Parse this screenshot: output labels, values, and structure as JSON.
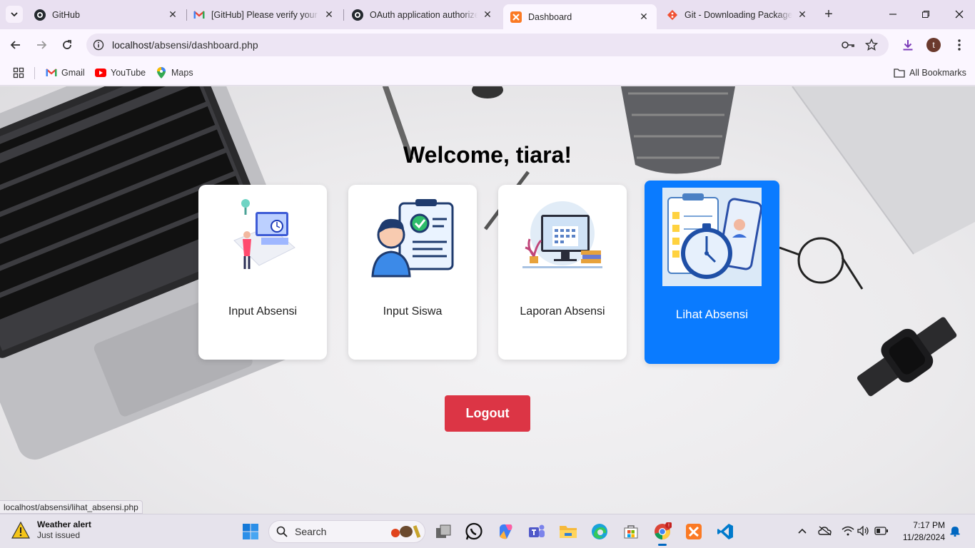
{
  "browser": {
    "tabs": [
      {
        "title": "GitHub",
        "icon": "github-icon",
        "active": false
      },
      {
        "title": "[GitHub] Please verify your d",
        "icon": "gmail-icon",
        "active": false
      },
      {
        "title": "OAuth application authorize",
        "icon": "github-icon",
        "active": false
      },
      {
        "title": "Dashboard",
        "icon": "xampp-icon",
        "active": true
      },
      {
        "title": "Git - Downloading Package",
        "icon": "git-icon",
        "active": false
      }
    ],
    "url_host": "localhost",
    "url_path": "/absensi/dashboard.php",
    "bookmarks": [
      {
        "label": "Gmail",
        "icon": "gmail-icon"
      },
      {
        "label": "YouTube",
        "icon": "youtube-icon"
      },
      {
        "label": "Maps",
        "icon": "maps-icon"
      }
    ],
    "all_bookmarks": "All Bookmarks",
    "profile_initial": "t"
  },
  "page": {
    "welcome": "Welcome, tiara!",
    "cards": [
      {
        "label": "Input Absensi",
        "highlighted": false
      },
      {
        "label": "Input Siswa",
        "highlighted": false
      },
      {
        "label": "Laporan Absensi",
        "highlighted": false
      },
      {
        "label": "Lihat Absensi",
        "highlighted": true
      }
    ],
    "logout": "Logout",
    "status_url": "localhost/absensi/lihat_absensi.php"
  },
  "taskbar": {
    "weather_title": "Weather alert",
    "weather_sub": "Just issued",
    "search_placeholder": "Search",
    "time": "7:17 PM",
    "date": "11/28/2024"
  },
  "colors": {
    "accent_card": "#0a7bff",
    "logout": "#dc3545",
    "chrome": "#e9e0f1"
  }
}
